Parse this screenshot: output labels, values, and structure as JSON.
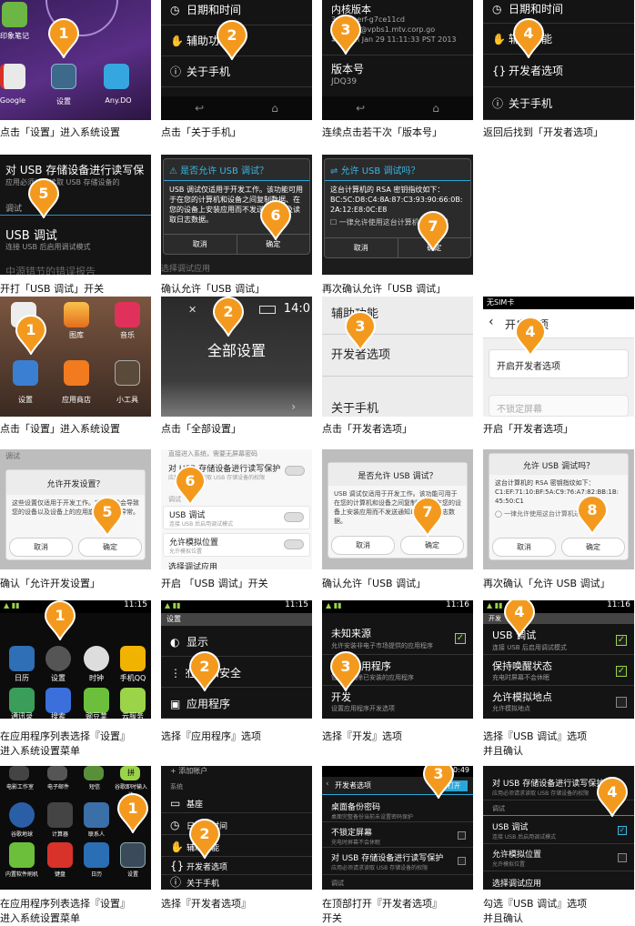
{
  "colors": {
    "pin": "#f39a1e",
    "android_blue": "#38b6e6",
    "toggle_on": "#8cd14f"
  },
  "captions": {
    "r1c1": "点击「设置」进入系统设置",
    "r1c2": "点击「关于手机」",
    "r1c3": "连续点击若干次「版本号」",
    "r1c4": "返回后找到「开发者选项」",
    "r2c1": "开打「USB 调试」开关",
    "r2c2": "确认允许「USB 调试」",
    "r2c3": "再次确认允许「USB 调试」",
    "r3c1": "点击「设置」进入系统设置",
    "r3c2": "点击「全部设置」",
    "r3c3": "点击「开发者选项」",
    "r3c4": "开启「开发者选项」",
    "r4c1": "确认「允许开发设置」",
    "r4c2": "开启 「USB 调试」开关",
    "r4c3": "确认允许「USB 调试」",
    "r4c4": "再次确认「允许 USB 调试」",
    "r5c1": "在应用程序列表选择『设置』\n进入系统设置菜单",
    "r5c2": "选择『应用程序』选项",
    "r5c3": "选择『开发』选项",
    "r5c4": "选择『USB 调试』选项\n并且确认",
    "r6c1": "在应用程序列表选择『设置』\n进入系统设置菜单",
    "r6c2": "选择『开发者选项』",
    "r6c3": "在顶部打开『开发者选项』\n开关",
    "r6c4": "勾选『USB 调试』选项\n并且确认"
  },
  "s11": {
    "pin": "1",
    "apps": [
      "印象笔记",
      "Google",
      "设置",
      "Any.DO"
    ]
  },
  "s12": {
    "pin": "2",
    "rows": [
      "日期和时间",
      "辅助功能",
      "关于手机"
    ],
    "icons": [
      "clock-icon",
      "hand-icon",
      "info-icon"
    ]
  },
  "s13": {
    "pin": "3",
    "label_kernel": "内核版本",
    "kernel_1": "3.0.8-perf-g7ce11cd",
    "kernel_2": "se-build@vpbs1.mtv.corp.go",
    "kernel_3": "#1 Mon Jan 29 11:11:33 PST 2013",
    "label_build": "版本号",
    "build": "JDQ39"
  },
  "s14": {
    "pin": "4",
    "rows": [
      "日期和时间",
      "辅助功能",
      "开发者选项",
      "关于手机"
    ]
  },
  "s21": {
    "pin": "5",
    "top_title": "对 USB 存储设备进行读写保",
    "top_sub": "应用必须请求读取 USB 存储设备的",
    "section": "调试",
    "usb_title": "USB 调试",
    "usb_sub": "连接 USB 后启用调试模式",
    "bottom": "中源错节的错误报告"
  },
  "s22": {
    "pin": "6",
    "title": "是否允许 USB 调试？",
    "body": "USB 调试仅适用于开发工作。该功能可用于在您的计算机和设备之间复制数据、在您的设备上安装应用而不发送通知以及读取日志数据。",
    "cancel": "取消",
    "ok": "确定",
    "bottom": "选择调试应用"
  },
  "s23": {
    "pin": "7",
    "title": "允许 USB 调试吗？",
    "body": "这台计算机的 RSA 密钥指纹如下：",
    "fingerprint": "BC:5C:D8:C4:8A:87:C3:93:90:66:0B:2A:12:E8:0C:E8",
    "checkbox": "一律允许使用这台计算机进行调试",
    "cancel": "取消",
    "ok": "确定"
  },
  "s31": {
    "pin": "1",
    "apps": [
      "",
      "图库",
      "音乐",
      "设置",
      "应用商店",
      "小工具"
    ]
  },
  "s32": {
    "pin": "2",
    "time": "14:0",
    "title": "全部设置"
  },
  "s33": {
    "pin": "3",
    "rows": [
      "辅助功能",
      "开发者选项",
      "关于手机"
    ]
  },
  "s34": {
    "pin": "4",
    "status": "无SIM卡",
    "title": "开启选项",
    "row1": "开启开发者选项",
    "row2": "不锁定屏幕"
  },
  "s41": {
    "pin": "5",
    "section": "调试",
    "title": "允许开发设置？",
    "body": "这些设置仅适用于开发工作。它们可能会导致您的设备以及设备上的应用崩溃或行为异常。",
    "cancel": "取消",
    "ok": "确定"
  },
  "s42": {
    "pin": "6",
    "top": "直接进入系统，需要无屏幕密码",
    "row1": "对 USB 存储设备进行读写保护",
    "row1_sub": "应用必须请求读取 USB 存储设备的权限",
    "section": "调试",
    "usb": "USB 调试",
    "usb_sub": "连接 USB 后启用调试模式",
    "mock": "允许模拟位置",
    "mock_sub": "允许模拟位置",
    "last": "选择调试应用"
  },
  "s43": {
    "pin": "7",
    "title": "是否允许 USB 调试？",
    "body": "USB 调试仅适用于开发工作。该功能可用于在您的计算机和设备之间复制数据、在您的设备上安装应用而不发送通知以及读取日志数据。",
    "cancel": "取消",
    "ok": "确定"
  },
  "s44": {
    "pin": "8",
    "title": "允许 USB 调试吗？",
    "body": "这台计算机的 RSA 密钥指纹如下：",
    "fingerprint": "C1:EF:71:10:BF:5A:C9:76:A7:82:BB:1B:45:50:C1",
    "checkbox": "一律允许使用这台计算机进行",
    "cancel": "取消",
    "ok": "确定"
  },
  "s51": {
    "pin": "1",
    "time": "11:15",
    "apps": [
      "日历",
      "设置",
      "时钟",
      "手机QQ",
      "通讯录",
      "搜索",
      "豌豆荚",
      "云服务"
    ]
  },
  "s52": {
    "pin": "2",
    "time": "11:15",
    "header": "设置",
    "rows": [
      "显示",
      "位置和安全",
      "应用程序"
    ]
  },
  "s53": {
    "pin": "3",
    "time": "11:16",
    "unknown": "未知来源",
    "unknown_sub": "允许安装非电子市场提供的应用程序",
    "manage": "管理应用程序",
    "manage_sub": "管理和删除已安装的应用程序",
    "dev": "开发",
    "dev_sub": "设置应用程序开发选项"
  },
  "s54": {
    "pin": "4",
    "time": "11:16",
    "header": "开发",
    "usb": "USB 调试",
    "usb_sub": "连接 USB 后启用调试模式",
    "awake": "保持唤醒状态",
    "awake_sub": "充电时屏幕不会休眠",
    "mock": "允许模拟地点",
    "mock_sub": "允许模拟地点"
  },
  "s61": {
    "pin": "1",
    "apps": [
      "电影工作室",
      "电子邮件",
      "短信",
      "谷歌即时输入法",
      "谷歌地球",
      "计算器",
      "联系人",
      "拼",
      "设置",
      "内置软件刷机",
      "键盘",
      "日历",
      "设置"
    ]
  },
  "s62": {
    "pin": "2",
    "top": "添加帐户",
    "section": "系统",
    "rows": [
      "基座",
      "日期和时间",
      "辅助功能",
      "开发者选项",
      "关于手机"
    ]
  },
  "s63": {
    "pin": "3",
    "time": "10:49",
    "header": "开发者选项",
    "switch": "打开",
    "row1": "桌面备份密码",
    "row1_sub": "桌面完整备份当前未设置密码保护",
    "row2": "不锁定屏幕",
    "row2_sub": "充电时屏幕不会休眠",
    "row3": "对 USB 存储设备进行读写保护",
    "row3_sub": "应用必须请求读取 USB 存储设备的权限",
    "section": "调试"
  },
  "s64": {
    "pin": "4",
    "row1": "对 USB 存储设备进行读写保护",
    "row1_sub": "应用必须请求读取 USB 存储设备的权限",
    "section": "调试",
    "usb": "USB 调试",
    "usb_sub": "连接 USB 后启用调试模式",
    "mock": "允许模拟位置",
    "mock_sub": "允许模拟位置",
    "last": "选择调试应用"
  }
}
